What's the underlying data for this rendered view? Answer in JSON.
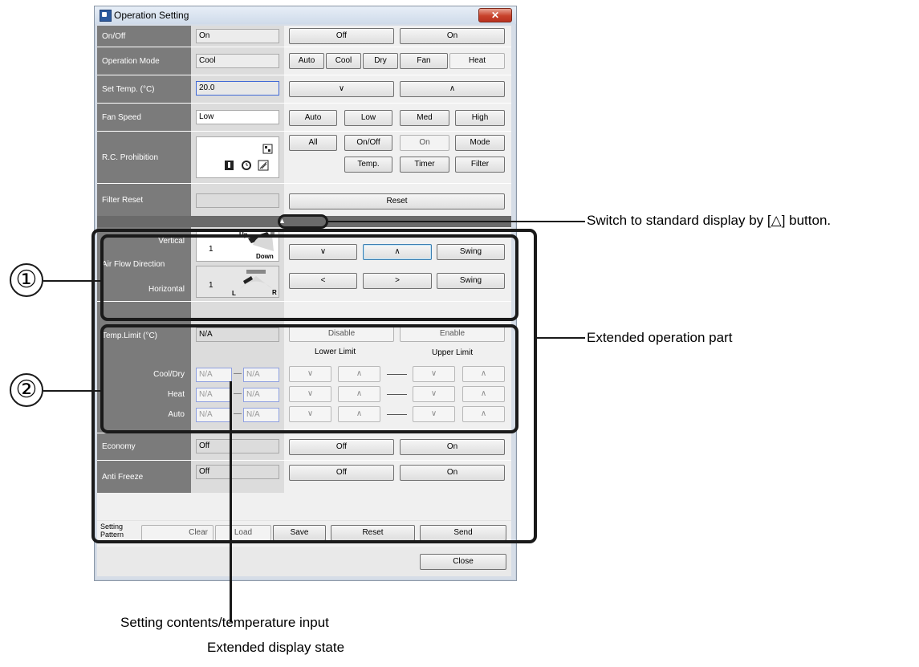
{
  "window": {
    "title": "Operation Setting",
    "close_glyph": "✕"
  },
  "rows": {
    "onoff": {
      "label": "On/Off",
      "value": "On",
      "buttons": [
        "Off",
        "On"
      ]
    },
    "mode": {
      "label": "Operation Mode",
      "value": "Cool",
      "buttons": [
        "Auto",
        "Cool",
        "Dry",
        "Fan",
        "Heat"
      ]
    },
    "settemp": {
      "label": "Set Temp. (°C)",
      "value": "20.0",
      "buttons": [
        "∨",
        "∧"
      ]
    },
    "fan": {
      "label": "Fan Speed",
      "value": "Low",
      "buttons": [
        "Auto",
        "Low",
        "Med",
        "High"
      ]
    },
    "rcp": {
      "label": "R.C. Prohibition",
      "buttons": [
        "All",
        "On/Off",
        "On",
        "Mode",
        "Temp.",
        "Timer",
        "Filter"
      ]
    },
    "filter": {
      "label": "Filter Reset",
      "value": "",
      "button": "Reset"
    }
  },
  "expand_arrow": "▲",
  "airflow": {
    "label": "Air Flow Direction",
    "vertical": {
      "label": "Vertical",
      "value": "1",
      "up": "Up",
      "down": "Down",
      "buttons": [
        "∨",
        "∧",
        "Swing"
      ]
    },
    "horizontal": {
      "label": "Horizontal",
      "value": "1",
      "l": "L",
      "r": "R",
      "buttons": [
        "<",
        ">",
        "Swing"
      ]
    }
  },
  "templimit": {
    "label": "Temp.Limit (°C)",
    "value": "N/A",
    "buttons": [
      "Disable",
      "Enable"
    ],
    "lower": "Lower Limit",
    "upper": "Upper Limit",
    "rows": [
      {
        "label": "Cool/Dry",
        "low": "N/A",
        "high": "N/A"
      },
      {
        "label": "Heat",
        "low": "N/A",
        "high": "N/A"
      },
      {
        "label": "Auto",
        "low": "N/A",
        "high": "N/A"
      }
    ],
    "dash": "—",
    "down": "∨",
    "up": "∧"
  },
  "economy": {
    "label": "Economy",
    "value": "Off",
    "buttons": [
      "Off",
      "On"
    ]
  },
  "antifreeze": {
    "label": "Anti Freeze",
    "value": "Off",
    "buttons": [
      "Off",
      "On"
    ]
  },
  "pattern": {
    "label": "Setting Pattern",
    "clear": "Clear",
    "load": "Load",
    "save": "Save",
    "reset": "Reset",
    "send": "Send"
  },
  "close_button": "Close",
  "annotations": {
    "switch": "Switch to standard display by [△] button.",
    "extended_part": "Extended operation part",
    "setting_contents": "Setting contents/temperature input",
    "extended_state": "Extended display state",
    "num1": "①",
    "num2": "②"
  }
}
